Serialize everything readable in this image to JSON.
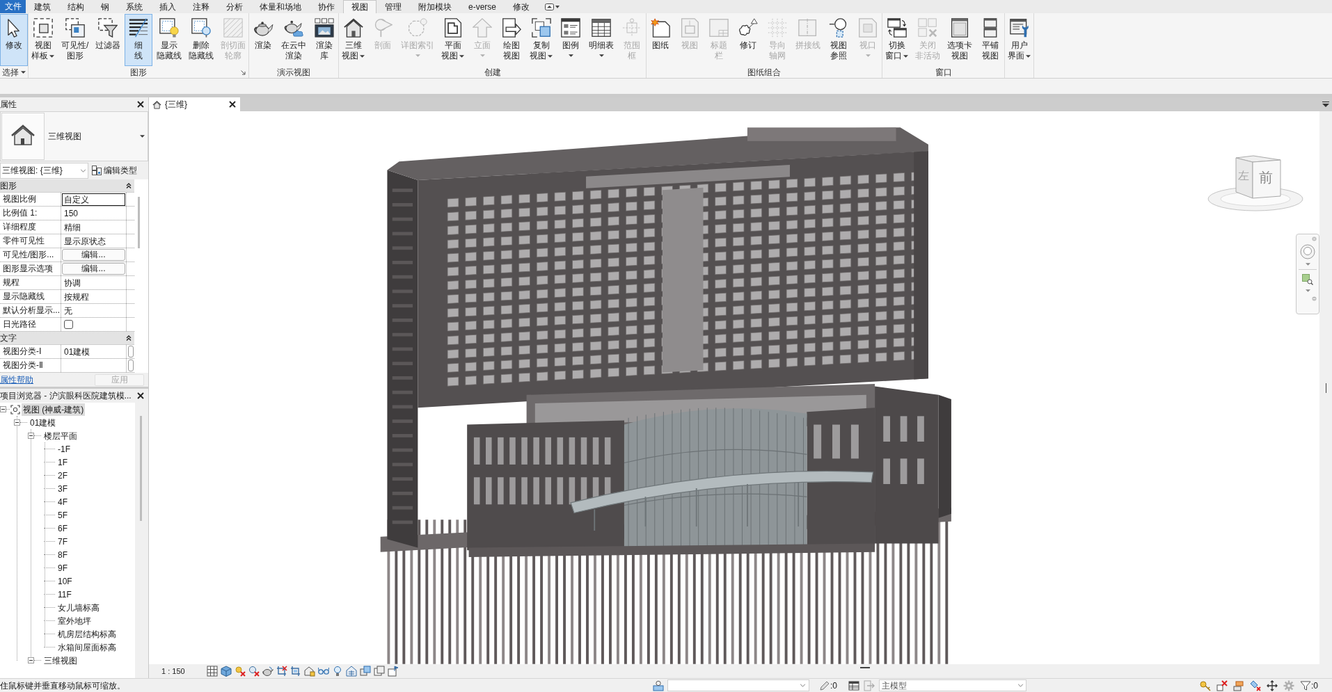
{
  "menu": {
    "file": "文件",
    "tabs": [
      {
        "label": "建筑",
        "selected": false
      },
      {
        "label": "结构",
        "selected": false
      },
      {
        "label": "钢",
        "selected": false
      },
      {
        "label": "系统",
        "selected": false
      },
      {
        "label": "插入",
        "selected": false
      },
      {
        "label": "注释",
        "selected": false
      },
      {
        "label": "分析",
        "selected": false
      },
      {
        "label": "体量和场地",
        "selected": false
      },
      {
        "label": "协作",
        "selected": false
      },
      {
        "label": "视图",
        "selected": true
      },
      {
        "label": "管理",
        "selected": false
      },
      {
        "label": "附加模块",
        "selected": false
      },
      {
        "label": "e-verse",
        "selected": false
      },
      {
        "label": "修改",
        "selected": false
      }
    ]
  },
  "ribbon": {
    "panels": [
      {
        "label": "选择",
        "dropdown": true,
        "launcher": false,
        "buttons": [
          {
            "lines": [
              "修改"
            ],
            "active": true,
            "disabled": false,
            "dropdown": false
          }
        ]
      },
      {
        "label": "图形",
        "dropdown": false,
        "launcher": true,
        "buttons": [
          {
            "lines": [
              "视图",
              "样板"
            ],
            "active": false,
            "disabled": false,
            "dropdown": true
          },
          {
            "lines": [
              "可见性/",
              "图形"
            ],
            "active": false,
            "disabled": false,
            "dropdown": false
          },
          {
            "lines": [
              "过滤器"
            ],
            "active": false,
            "disabled": false,
            "dropdown": false
          },
          {
            "lines": [
              "细",
              "线"
            ],
            "active": true,
            "disabled": false,
            "dropdown": false
          },
          {
            "lines": [
              "显示",
              "隐藏线"
            ],
            "active": false,
            "disabled": false,
            "dropdown": false
          },
          {
            "lines": [
              "删除",
              "隐藏线"
            ],
            "active": false,
            "disabled": false,
            "dropdown": false
          },
          {
            "lines": [
              "剖切面",
              "轮廓"
            ],
            "active": false,
            "disabled": true,
            "dropdown": false
          }
        ]
      },
      {
        "label": "演示视图",
        "dropdown": false,
        "launcher": false,
        "buttons": [
          {
            "lines": [
              "渲染"
            ],
            "active": false,
            "disabled": false,
            "dropdown": false
          },
          {
            "lines": [
              "在云中",
              "渲染"
            ],
            "active": false,
            "disabled": false,
            "dropdown": false
          },
          {
            "lines": [
              "渲染",
              "库"
            ],
            "active": false,
            "disabled": false,
            "dropdown": false
          }
        ]
      },
      {
        "label": "创建",
        "dropdown": false,
        "launcher": false,
        "buttons": [
          {
            "lines": [
              "三维",
              "视图"
            ],
            "active": false,
            "disabled": false,
            "dropdown": true
          },
          {
            "lines": [
              "剖面"
            ],
            "active": false,
            "disabled": true,
            "dropdown": false
          },
          {
            "lines": [
              "详图索引"
            ],
            "active": false,
            "disabled": true,
            "dropdown": true
          },
          {
            "lines": [
              "平面",
              "视图"
            ],
            "active": false,
            "disabled": false,
            "dropdown": true
          },
          {
            "lines": [
              "立面"
            ],
            "active": false,
            "disabled": true,
            "dropdown": true
          },
          {
            "lines": [
              "绘图",
              "视图"
            ],
            "active": false,
            "disabled": false,
            "dropdown": false
          },
          {
            "lines": [
              "复制",
              "视图"
            ],
            "active": false,
            "disabled": false,
            "dropdown": true
          },
          {
            "lines": [
              "图例"
            ],
            "active": false,
            "disabled": false,
            "dropdown": true
          },
          {
            "lines": [
              "明细表"
            ],
            "active": false,
            "disabled": false,
            "dropdown": true
          },
          {
            "lines": [
              "范围",
              "框"
            ],
            "active": false,
            "disabled": true,
            "dropdown": false
          }
        ]
      },
      {
        "label": "图纸组合",
        "dropdown": false,
        "launcher": false,
        "buttons": [
          {
            "lines": [
              "图纸"
            ],
            "active": false,
            "disabled": false,
            "dropdown": false
          },
          {
            "lines": [
              "视图"
            ],
            "active": false,
            "disabled": true,
            "dropdown": false
          },
          {
            "lines": [
              "标题",
              "栏"
            ],
            "active": false,
            "disabled": true,
            "dropdown": false
          },
          {
            "lines": [
              "修订"
            ],
            "active": false,
            "disabled": false,
            "dropdown": false
          },
          {
            "lines": [
              "导向",
              "轴网"
            ],
            "active": false,
            "disabled": true,
            "dropdown": false
          },
          {
            "lines": [
              "拼接线"
            ],
            "active": false,
            "disabled": true,
            "dropdown": false
          },
          {
            "lines": [
              "视图",
              "参照"
            ],
            "active": false,
            "disabled": false,
            "dropdown": false
          },
          {
            "lines": [
              "视口"
            ],
            "active": false,
            "disabled": true,
            "dropdown": true
          }
        ]
      },
      {
        "label": "窗口",
        "dropdown": false,
        "launcher": false,
        "buttons": [
          {
            "lines": [
              "切换",
              "窗口"
            ],
            "active": false,
            "disabled": false,
            "dropdown": true
          },
          {
            "lines": [
              "关闭",
              "非活动"
            ],
            "active": false,
            "disabled": true,
            "dropdown": false
          },
          {
            "lines": [
              "选项卡",
              "视图"
            ],
            "active": false,
            "disabled": false,
            "dropdown": false
          },
          {
            "lines": [
              "平铺",
              "视图"
            ],
            "active": false,
            "disabled": false,
            "dropdown": false
          }
        ]
      },
      {
        "dropdown": false,
        "launcher": false,
        "buttons": [
          {
            "lines": [
              "用户",
              "界面"
            ],
            "active": false,
            "disabled": false,
            "dropdown": true
          }
        ]
      }
    ]
  },
  "properties": {
    "title": "属性",
    "type_name": "三维视图",
    "type_selector": "三维视图: {三维}",
    "edit_type": "编辑类型",
    "groups": [
      {
        "label": "图形",
        "expanded": true,
        "rows": [
          {
            "name": "视图比例",
            "value": "自定义",
            "kind": "text",
            "selected": true
          },
          {
            "name": "比例值 1:",
            "value": "150",
            "kind": "text",
            "selected": false
          },
          {
            "name": "详细程度",
            "value": "精细",
            "kind": "text",
            "selected": false
          },
          {
            "name": "零件可见性",
            "value": "显示原状态",
            "kind": "text",
            "selected": false
          },
          {
            "name": "可见性/图形...",
            "value": "编辑...",
            "kind": "button",
            "selected": false
          },
          {
            "name": "图形显示选项",
            "value": "编辑...",
            "kind": "button",
            "selected": false
          },
          {
            "name": "规程",
            "value": "协调",
            "kind": "text",
            "selected": false
          },
          {
            "name": "显示隐藏线",
            "value": "按规程",
            "kind": "text",
            "selected": false
          },
          {
            "name": "默认分析显示...",
            "value": "无",
            "kind": "text",
            "selected": false
          },
          {
            "name": "日光路径",
            "kind": "checkbox",
            "checked": false,
            "selected": false
          }
        ]
      },
      {
        "label": "文字",
        "expanded": true,
        "rows": [
          {
            "name": "视图分类-Ⅰ",
            "value": "01建模",
            "kind": "picker",
            "selected": false
          },
          {
            "name": "视图分类-Ⅱ",
            "kind": "picker",
            "selected": false
          }
        ]
      }
    ],
    "help": "属性帮助",
    "apply": {
      "label": "应用",
      "disabled": true
    }
  },
  "browser": {
    "title": "项目浏览器 - 沪滨眼科医院建筑模...",
    "tree": [
      {
        "label": "视图 (神威-建筑)",
        "expanded": true,
        "selected": true,
        "children": [
          {
            "label": "01建模",
            "expanded": true,
            "selected": false,
            "children": [
              {
                "label": "楼层平面",
                "expanded": true,
                "selected": false,
                "children": [
                  {
                    "label": "-1F",
                    "selected": false
                  },
                  {
                    "label": "1F",
                    "selected": false
                  },
                  {
                    "label": "2F",
                    "selected": false
                  },
                  {
                    "label": "3F",
                    "selected": false
                  },
                  {
                    "label": "4F",
                    "selected": false
                  },
                  {
                    "label": "5F",
                    "selected": false
                  },
                  {
                    "label": "6F",
                    "selected": false
                  },
                  {
                    "label": "7F",
                    "selected": false
                  },
                  {
                    "label": "8F",
                    "selected": false
                  },
                  {
                    "label": "9F",
                    "selected": false
                  },
                  {
                    "label": "10F",
                    "selected": false
                  },
                  {
                    "label": "11F",
                    "selected": false
                  },
                  {
                    "label": "女儿墙标高",
                    "selected": false
                  },
                  {
                    "label": "室外地坪",
                    "selected": false
                  },
                  {
                    "label": "机房层结构标高",
                    "selected": false
                  },
                  {
                    "label": "水箱间屋面标高",
                    "selected": false
                  }
                ]
              },
              {
                "label": "三维视图",
                "expanded": true,
                "selected": false
              }
            ]
          }
        ]
      }
    ]
  },
  "view": {
    "tab": "{三维}",
    "cube_faces": [
      "左",
      "前"
    ],
    "scale": "1 : 150"
  },
  "status_bar": {
    "message": "住鼠标键并垂直移动鼠标可缩放。",
    "editable_count": ":0",
    "design_option": "主模型",
    "filter_count": ":0"
  }
}
